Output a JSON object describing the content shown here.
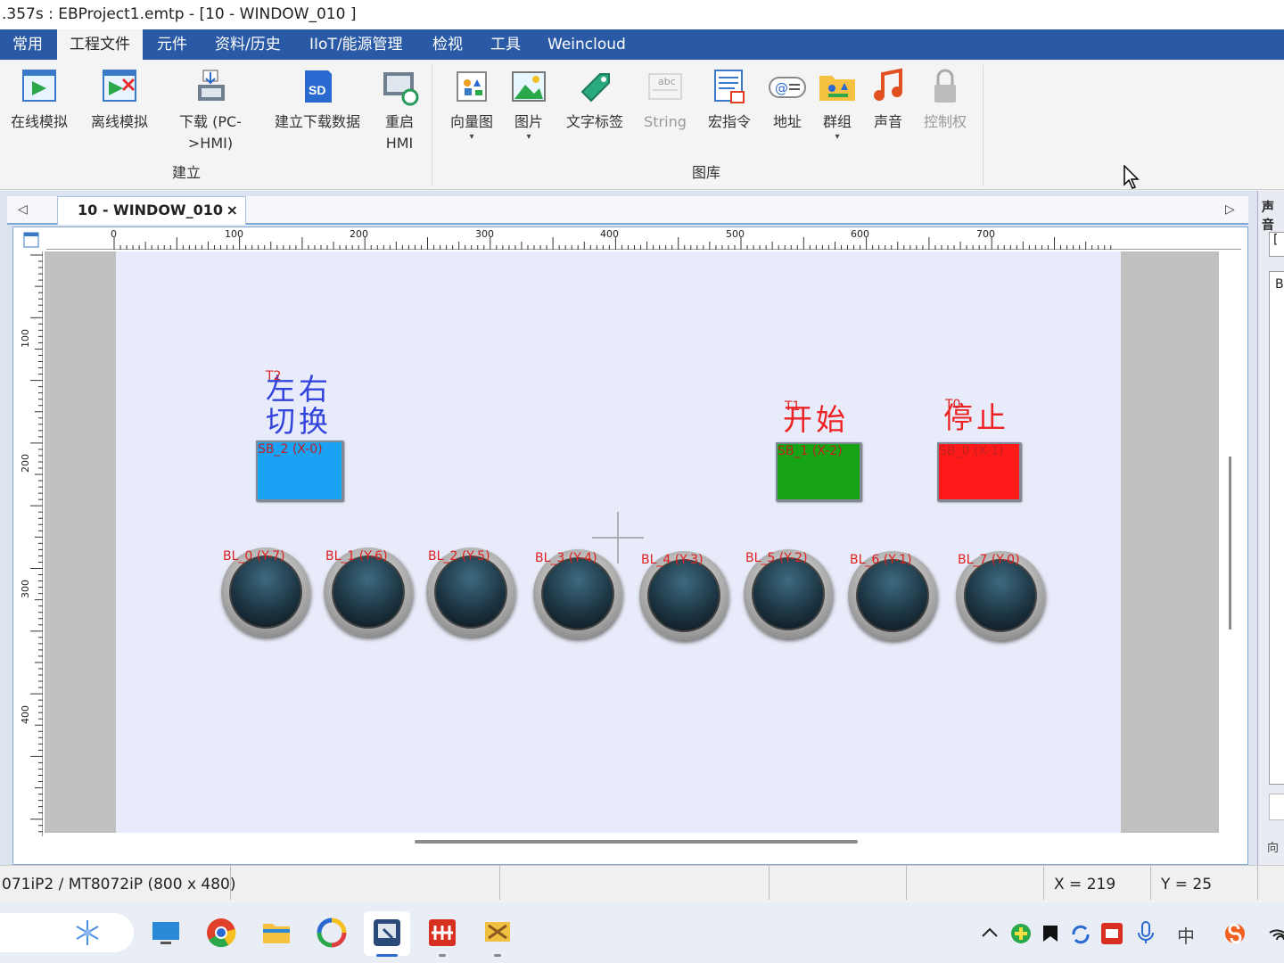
{
  "window": {
    "title": ".357s : EBProject1.emtp - [10 - WINDOW_010 ]"
  },
  "menu": {
    "tabs": [
      "常用",
      "工程文件",
      "元件",
      "资料/历史",
      "IIoT/能源管理",
      "检视",
      "工具",
      "Weincloud"
    ]
  },
  "ribbon": {
    "build": {
      "label": "建立",
      "items": [
        {
          "label": "在线模拟",
          "icon": "online-simulation-icon"
        },
        {
          "label": "离线模拟",
          "icon": "offline-simulation-icon"
        },
        {
          "label": "下载 (PC-",
          "label2": ">HMI)",
          "icon": "download-icon"
        },
        {
          "label": "建立下载数据",
          "icon": "sd-card-icon",
          "icon_text": "SD"
        },
        {
          "label": "重启",
          "label2": "HMI",
          "icon": "restart-hmi-icon"
        }
      ]
    },
    "library": {
      "label": "图库",
      "items": [
        {
          "label": "向量图",
          "icon": "vector-image-icon",
          "dropdown": "▾"
        },
        {
          "label": "图片",
          "icon": "picture-icon",
          "dropdown": "▾"
        },
        {
          "label": "文字标签",
          "icon": "text-tag-icon"
        },
        {
          "label": "String",
          "icon": "string-icon",
          "icon_text": "abc",
          "disabled": true
        },
        {
          "label": "宏指令",
          "icon": "macro-icon"
        },
        {
          "label": "地址",
          "icon": "address-icon",
          "icon_text": "@"
        },
        {
          "label": "群组",
          "icon": "group-icon",
          "dropdown": "▾"
        },
        {
          "label": "声音",
          "icon": "sound-icon"
        },
        {
          "label": "控制权",
          "icon": "lock-icon",
          "disabled": true
        }
      ]
    }
  },
  "editor": {
    "tab_label": "10 - WINDOW_010",
    "tab_close": "×",
    "left_arrow": "◁",
    "right_arrow": "▷",
    "ruler_h": [
      "0",
      "100",
      "200",
      "300",
      "400",
      "500",
      "600",
      "700"
    ],
    "ruler_v": [
      "100",
      "200",
      "300",
      "400"
    ]
  },
  "hmi": {
    "switch_text_line1": "左右",
    "switch_text_line2": "切换",
    "switch_text_overlay": "T2",
    "start_text": "开始",
    "start_overlay": "T1",
    "stop_text": "停止",
    "stop_overlay": "T0",
    "buttons": [
      {
        "tag": "SB_2 (X-0)",
        "color": "#1aa3f5"
      },
      {
        "tag": "SB_1 (X-2)",
        "color": "#16a416"
      },
      {
        "tag": "SB_0 (X-1)",
        "color": "#ff1a1a"
      }
    ],
    "lamps": [
      "BL_0 (Y-7)",
      "BL_1 (Y-6)",
      "BL_2 (Y-5)",
      "BL_3 (Y-4)",
      "BL_4 (Y-3)",
      "BL_5 (Y-2)",
      "BL_6 (Y-1)",
      "BL_7 (Y-0)"
    ]
  },
  "right_panel": {
    "title": "声音",
    "line1": "[",
    "line2": "B",
    "bottom": "向"
  },
  "status": {
    "model": "071iP2 / MT8072iP (800 x 480)",
    "x": "X = 219",
    "y": "Y = 25"
  },
  "taskbar": {
    "icons": [
      "snowflake-widget-icon",
      "desktop-icon",
      "chrome-icon",
      "file-explorer-icon",
      "pinwheel-icon",
      "easybuilder-icon",
      "red-app-icon",
      "tools-icon"
    ],
    "tray": [
      "chevron-up-icon",
      "green-plus-icon",
      "shield-icon",
      "sync-icon",
      "red-app-icon",
      "mic-icon",
      "ime-icon",
      "sogou-icon",
      "wifi-icon"
    ],
    "ime_label": "中"
  },
  "colors": {
    "menubar": "#2a5aa6",
    "hmi_bg": "#e8ebfa",
    "text_blue": "#3344dd",
    "text_red": "#ee2222"
  }
}
